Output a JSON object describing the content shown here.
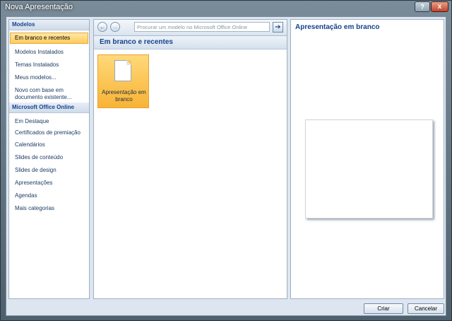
{
  "window": {
    "title": "Nova Apresentação",
    "help": "?",
    "close": "x"
  },
  "left_panel": {
    "section1": "Modelos",
    "items1": [
      "Em branco e recentes",
      "Modelos Instalados",
      "Temas Instalados",
      "Meus modelos...",
      "Novo com base em documento existente..."
    ],
    "section2": "Microsoft Office Online",
    "items2": [
      "Em Destaque",
      "Certificados de premiação",
      "Calendários",
      "Slides de conteúdo",
      "Slides de design",
      "Apresentações",
      "Agendas",
      "Mais categorias"
    ]
  },
  "middle_panel": {
    "search_placeholder": "Procurar um modelo no Microsoft Office Online",
    "header": "Em branco e recentes",
    "template_label": "Apresentação em branco"
  },
  "right_panel": {
    "title": "Apresentação em branco"
  },
  "buttons": {
    "create": "Criar",
    "cancel": "Cancelar"
  }
}
